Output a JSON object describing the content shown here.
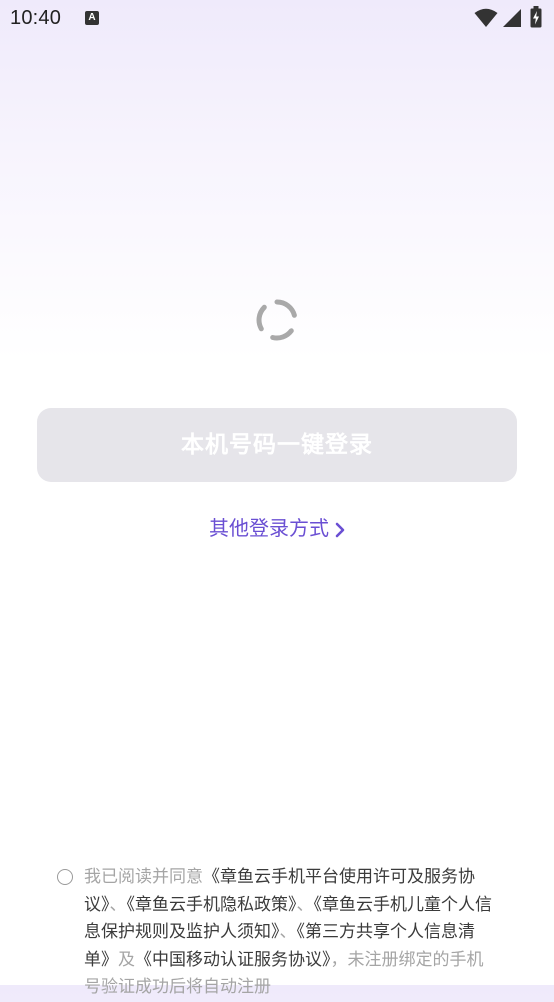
{
  "status_bar": {
    "time": "10:40",
    "notification_icon": "font-a-icon",
    "notification_letter": "A",
    "icons": [
      "wifi-icon",
      "signal-icon",
      "battery-charging-icon"
    ]
  },
  "loading": {
    "icon": "spinner-icon"
  },
  "login": {
    "one_click_label": "本机号码一键登录",
    "other_methods_label": "其他登录方式",
    "other_methods_icon": "chevron-right-icon"
  },
  "agreement": {
    "prefix": "我已阅读并同意",
    "doc1": "《章鱼云手机平台使用许可及服务协议》",
    "sep1": "、",
    "doc2": "《章鱼云手机隐私政策》",
    "sep2": "、",
    "doc3": "《章鱼云手机儿童个人信息保护规则及监护人须知》",
    "sep3": "、",
    "doc4": "《第三方共享个人信息清单》",
    "conj": "及",
    "doc5": "《中国移动认证服务协议》",
    "suffix": "，未注册绑定的手机号验证成功后将自动注册"
  },
  "colors": {
    "accent": "#6a4fd3",
    "button_disabled": "#e6e5ea",
    "link_text": "#3b3b3b",
    "muted_text": "#a5a5a5"
  }
}
